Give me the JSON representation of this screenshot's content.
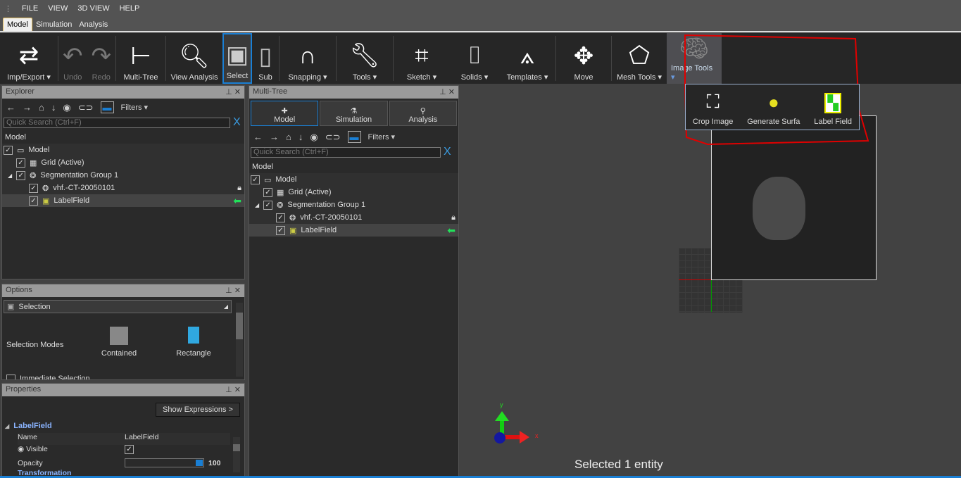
{
  "menu": [
    "FILE",
    "VIEW",
    "3D VIEW",
    "HELP"
  ],
  "ribbon_tabs": [
    {
      "label": "Model",
      "active": true
    },
    {
      "label": "Simulation"
    },
    {
      "label": "Analysis"
    }
  ],
  "ribbon": {
    "imp_export": "Imp/Export",
    "undo": "Undo",
    "redo": "Redo",
    "multi_tree": "Multi-Tree",
    "view_analysis": "View Analysis",
    "select": "Select",
    "sub": "Sub",
    "snapping": "Snapping",
    "tools": "Tools",
    "sketch": "Sketch",
    "solids": "Solids",
    "templates": "Templates",
    "move": "Move",
    "mesh_tools": "Mesh Tools",
    "image_tools": "Image Tools"
  },
  "image_tools_menu": [
    {
      "label": "Crop Image",
      "icon": "brain-crop-icon"
    },
    {
      "label": "Generate Surfa",
      "icon": "brain-yellow-icon"
    },
    {
      "label": "Label Field",
      "icon": "label-field-icon"
    }
  ],
  "explorer": {
    "title": "Explorer",
    "filters": "Filters",
    "search_placeholder": "Quick Search (Ctrl+F)",
    "clear": "X",
    "header": "Model",
    "items": [
      {
        "label": "Model",
        "checked": true
      },
      {
        "label": "Grid (Active)",
        "checked": true
      },
      {
        "label": "Segmentation Group 1",
        "checked": true
      },
      {
        "label": "vhf.-CT-20050101",
        "checked": true,
        "locked": true
      },
      {
        "label": "LabelField",
        "checked": true,
        "selected": true
      }
    ]
  },
  "multitree": {
    "title": "Multi-Tree",
    "tabs": [
      "Model",
      "Simulation",
      "Analysis"
    ],
    "filters": "Filters",
    "search_placeholder": "Quick Search (Ctrl+F)",
    "clear": "X",
    "header": "Model",
    "items": [
      {
        "label": "Model"
      },
      {
        "label": "Grid (Active)"
      },
      {
        "label": "Segmentation Group 1"
      },
      {
        "label": "vhf.-CT-20050101"
      },
      {
        "label": "LabelField"
      }
    ]
  },
  "options": {
    "title": "Options",
    "dropdown": "Selection",
    "modes_label": "Selection Modes",
    "modes": [
      "Contained",
      "Rectangle"
    ],
    "immediate": "Immediate Selection"
  },
  "properties": {
    "title": "Properties",
    "show_expressions": "Show Expressions >",
    "group": "LabelField",
    "name_label": "Name",
    "name_value": "LabelField",
    "visible_label": "Visible",
    "visible": true,
    "opacity_label": "Opacity",
    "opacity": 100,
    "transformation": "Transformation"
  },
  "viewport": {
    "status": "Selected 1 entity",
    "axis_x": "x",
    "axis_y": "y"
  },
  "colors": {
    "accent": "#1a7fd4",
    "annotation": "#e00000",
    "green_arrow": "#22e05a"
  }
}
